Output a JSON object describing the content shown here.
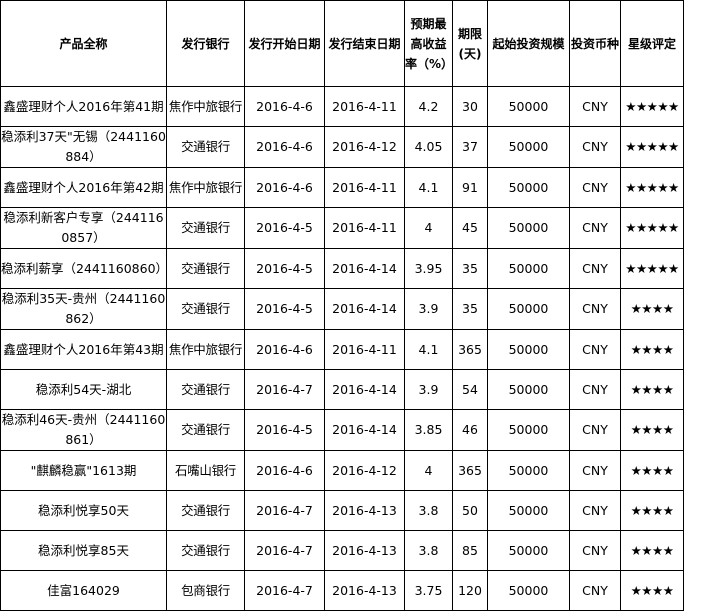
{
  "table": {
    "headers": [
      "产品全称",
      "发行银行",
      "发行开始日期",
      "发行结束日期",
      "预期最高收益率（%）",
      "期限(天)",
      "起始投资规模",
      "投资币种",
      "星级评定"
    ],
    "rows": [
      [
        "鑫盛理财个人2016年第41期",
        "焦作中旅银行",
        "2016-4-6",
        "2016-4-11",
        "4.2",
        "30",
        "50000",
        "CNY",
        "★★★★★"
      ],
      [
        "稳添利37天\"无锡（2441160884）",
        "交通银行",
        "2016-4-6",
        "2016-4-12",
        "4.05",
        "37",
        "50000",
        "CNY",
        "★★★★★"
      ],
      [
        "鑫盛理财个人2016年第42期",
        "焦作中旅银行",
        "2016-4-6",
        "2016-4-11",
        "4.1",
        "91",
        "50000",
        "CNY",
        "★★★★★"
      ],
      [
        "稳添利新客户专享（2441160857）",
        "交通银行",
        "2016-4-5",
        "2016-4-11",
        "4",
        "45",
        "50000",
        "CNY",
        "★★★★★"
      ],
      [
        "稳添利薪享（2441160860）",
        "交通银行",
        "2016-4-5",
        "2016-4-14",
        "3.95",
        "35",
        "50000",
        "CNY",
        "★★★★★"
      ],
      [
        "稳添利35天-贵州（2441160862）",
        "交通银行",
        "2016-4-5",
        "2016-4-14",
        "3.9",
        "35",
        "50000",
        "CNY",
        "★★★★"
      ],
      [
        "鑫盛理财个人2016年第43期",
        "焦作中旅银行",
        "2016-4-6",
        "2016-4-11",
        "4.1",
        "365",
        "50000",
        "CNY",
        "★★★★"
      ],
      [
        "稳添利54天-湖北",
        "交通银行",
        "2016-4-7",
        "2016-4-14",
        "3.9",
        "54",
        "50000",
        "CNY",
        "★★★★"
      ],
      [
        "稳添利46天-贵州（2441160861）",
        "交通银行",
        "2016-4-5",
        "2016-4-14",
        "3.85",
        "46",
        "50000",
        "CNY",
        "★★★★"
      ],
      [
        "\"麒麟稳赢\"1613期",
        "石嘴山银行",
        "2016-4-6",
        "2016-4-12",
        "4",
        "365",
        "50000",
        "CNY",
        "★★★★"
      ],
      [
        "稳添利悦享50天",
        "交通银行",
        "2016-4-7",
        "2016-4-13",
        "3.8",
        "50",
        "50000",
        "CNY",
        "★★★★"
      ],
      [
        "稳添利悦享85天",
        "交通银行",
        "2016-4-7",
        "2016-4-13",
        "3.8",
        "85",
        "50000",
        "CNY",
        "★★★★"
      ],
      [
        "佳富164029",
        "包商银行",
        "2016-4-7",
        "2016-4-13",
        "3.75",
        "120",
        "50000",
        "CNY",
        "★★★★"
      ]
    ]
  }
}
